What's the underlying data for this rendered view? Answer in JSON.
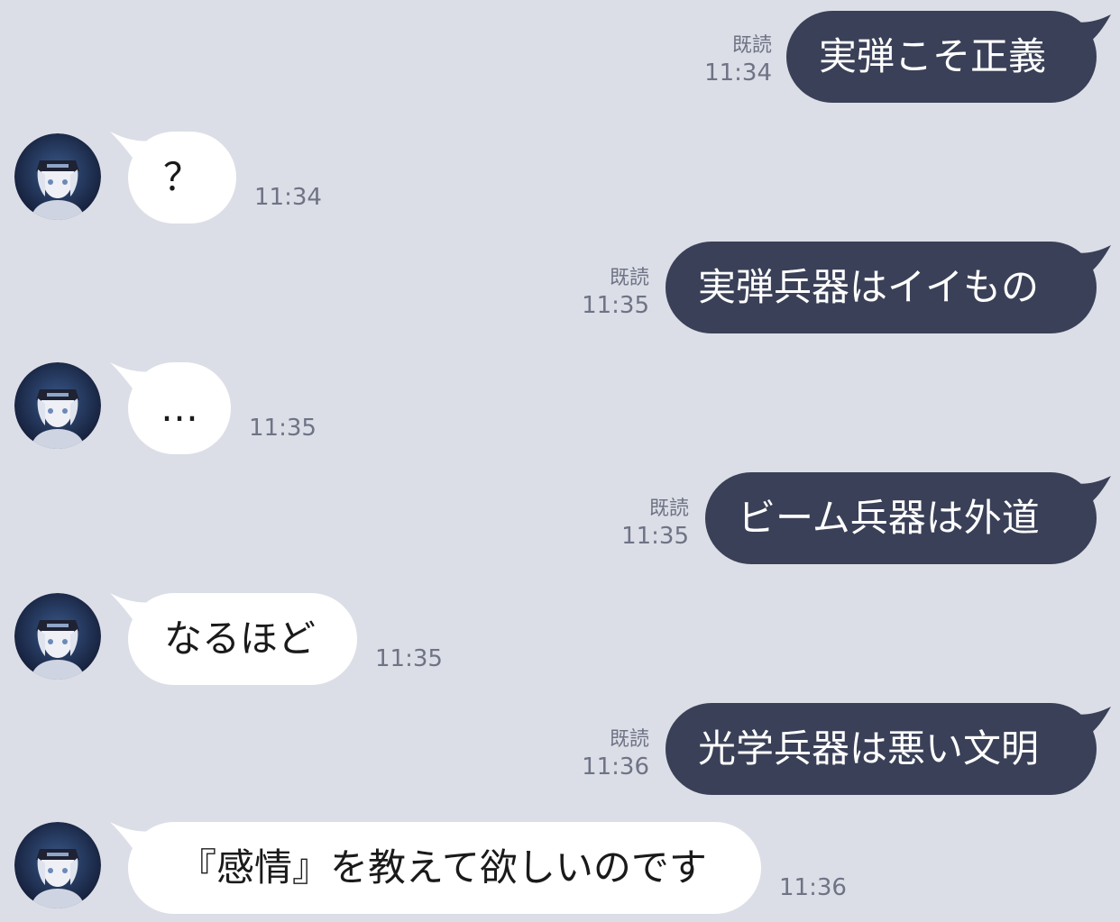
{
  "messages": [
    {
      "side": "out",
      "text": "実弾こそ正義",
      "read": "既読",
      "time": "11:34"
    },
    {
      "side": "in",
      "text": "？",
      "time": "11:34"
    },
    {
      "side": "out",
      "text": "実弾兵器はイイもの",
      "read": "既読",
      "time": "11:35"
    },
    {
      "side": "in",
      "text": "…",
      "time": "11:35"
    },
    {
      "side": "out",
      "text": "ビーム兵器は外道",
      "read": "既読",
      "time": "11:35"
    },
    {
      "side": "in",
      "text": "なるほど",
      "time": "11:35"
    },
    {
      "side": "out",
      "text": "光学兵器は悪い文明",
      "read": "既読",
      "time": "11:36"
    },
    {
      "side": "in",
      "text": "『感情』を教えて欲しいのです",
      "time": "11:36"
    }
  ],
  "colors": {
    "background": "#dcdee7",
    "outgoing_bubble": "#3a4057",
    "incoming_bubble": "#ffffff",
    "meta_text": "#6e7385"
  },
  "icons": {
    "avatar": "android-girl-avatar-icon"
  }
}
